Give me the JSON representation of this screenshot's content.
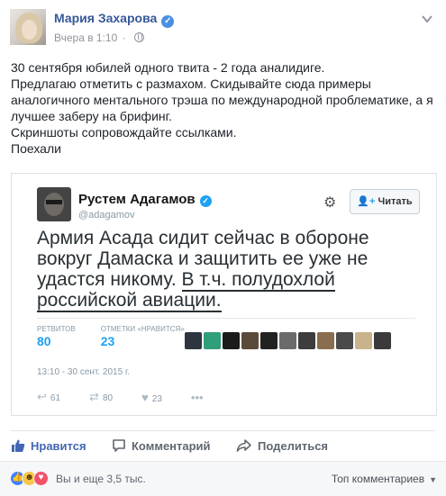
{
  "post": {
    "author": "Мария Захарова",
    "timestamp": "Вчера в 1:10",
    "body": [
      "30 сентября юбилей одного твита - 2 года аналидиге.",
      "Предлагаю отметить с размахом. Скидывайте сюда примеры аналогичного ментального трэша по международной проблематике, а я лучшее заберу на брифинг.",
      "Скриншоты сопровождайте ссылками.",
      "Поехали"
    ]
  },
  "embed": {
    "name": "Рустем Адагамов",
    "handle": "@adagamov",
    "follow_label": "Читать",
    "text_line1": "Армия Асада сидит сейчас в обороне вокруг Дамаска и защитить ее уже не удастся никому. ",
    "text_underlined": "В т.ч. полудохлой российской авиации.",
    "retweets_label": "РЕТВИТОВ",
    "retweets_value": "80",
    "likes_label": "ОТМЕТКИ «НРАВИТСЯ»",
    "likes_value": "23",
    "time": "13:10 - 30 сент. 2015 г.",
    "reply_count": "61",
    "retweet_count": "80",
    "like_count": "23",
    "liker_colors": [
      "#2e3440",
      "#2f9e7a",
      "#1b1b1b",
      "#5a4a3a",
      "#222222",
      "#6b6b6b",
      "#3d3d3d",
      "#8a6d4e",
      "#4a4a4a",
      "#c9b38c",
      "#3a3a3a"
    ]
  },
  "actions": {
    "like": "Нравится",
    "comment": "Комментарий",
    "share": "Поделиться"
  },
  "reactions": {
    "count_text": "Вы и еще 3,5 тыс.",
    "top_comments": "Топ комментариев"
  },
  "colors": {
    "link": "#365899",
    "accent": "#4267b2",
    "twitter": "#1da1f2"
  }
}
